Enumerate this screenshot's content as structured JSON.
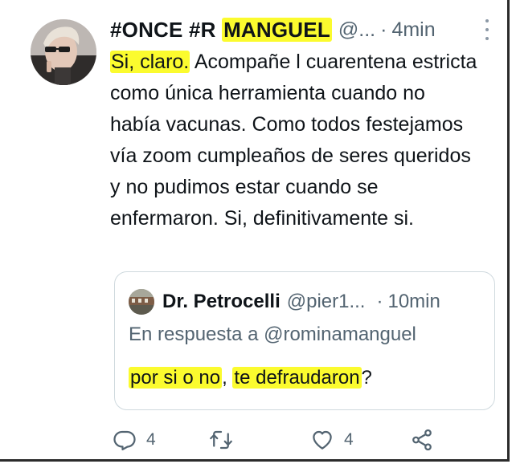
{
  "tweet": {
    "display_name": "#ONCE #R MANGUEL",
    "display_name_prefix": "#ONCE #R ",
    "display_name_highlight": "MANGUEL",
    "handle": "@...",
    "separator": "·",
    "time": "4min",
    "text_highlight": "Si, claro.",
    "text_rest": " Acompañe l cuarentena estricta como única herramienta cuando no había vacunas. Como todos festejamos vía zoom cumpleaños de seres queridos y no pudimos estar cuando se enfermaron. Si, definitivamente si.",
    "avatar_icon": "user-avatar",
    "more_icon": "more-vertical-icon"
  },
  "quoted": {
    "display_name": "Dr. Petrocelli",
    "handle": "@pier1...",
    "separator": "·",
    "time": "10min",
    "reply_to": "En respuesta a @rominamanguel",
    "text_part1": "por si o no",
    "text_comma": ",",
    "text_space": " ",
    "text_part2": "te defraudaron",
    "text_end": "?"
  },
  "actions": {
    "reply_count": "4",
    "retweet_count": "",
    "like_count": "4"
  },
  "colors": {
    "highlight": "#fbfb2e",
    "secondary_text": "#536471",
    "border": "#cfd9de"
  }
}
